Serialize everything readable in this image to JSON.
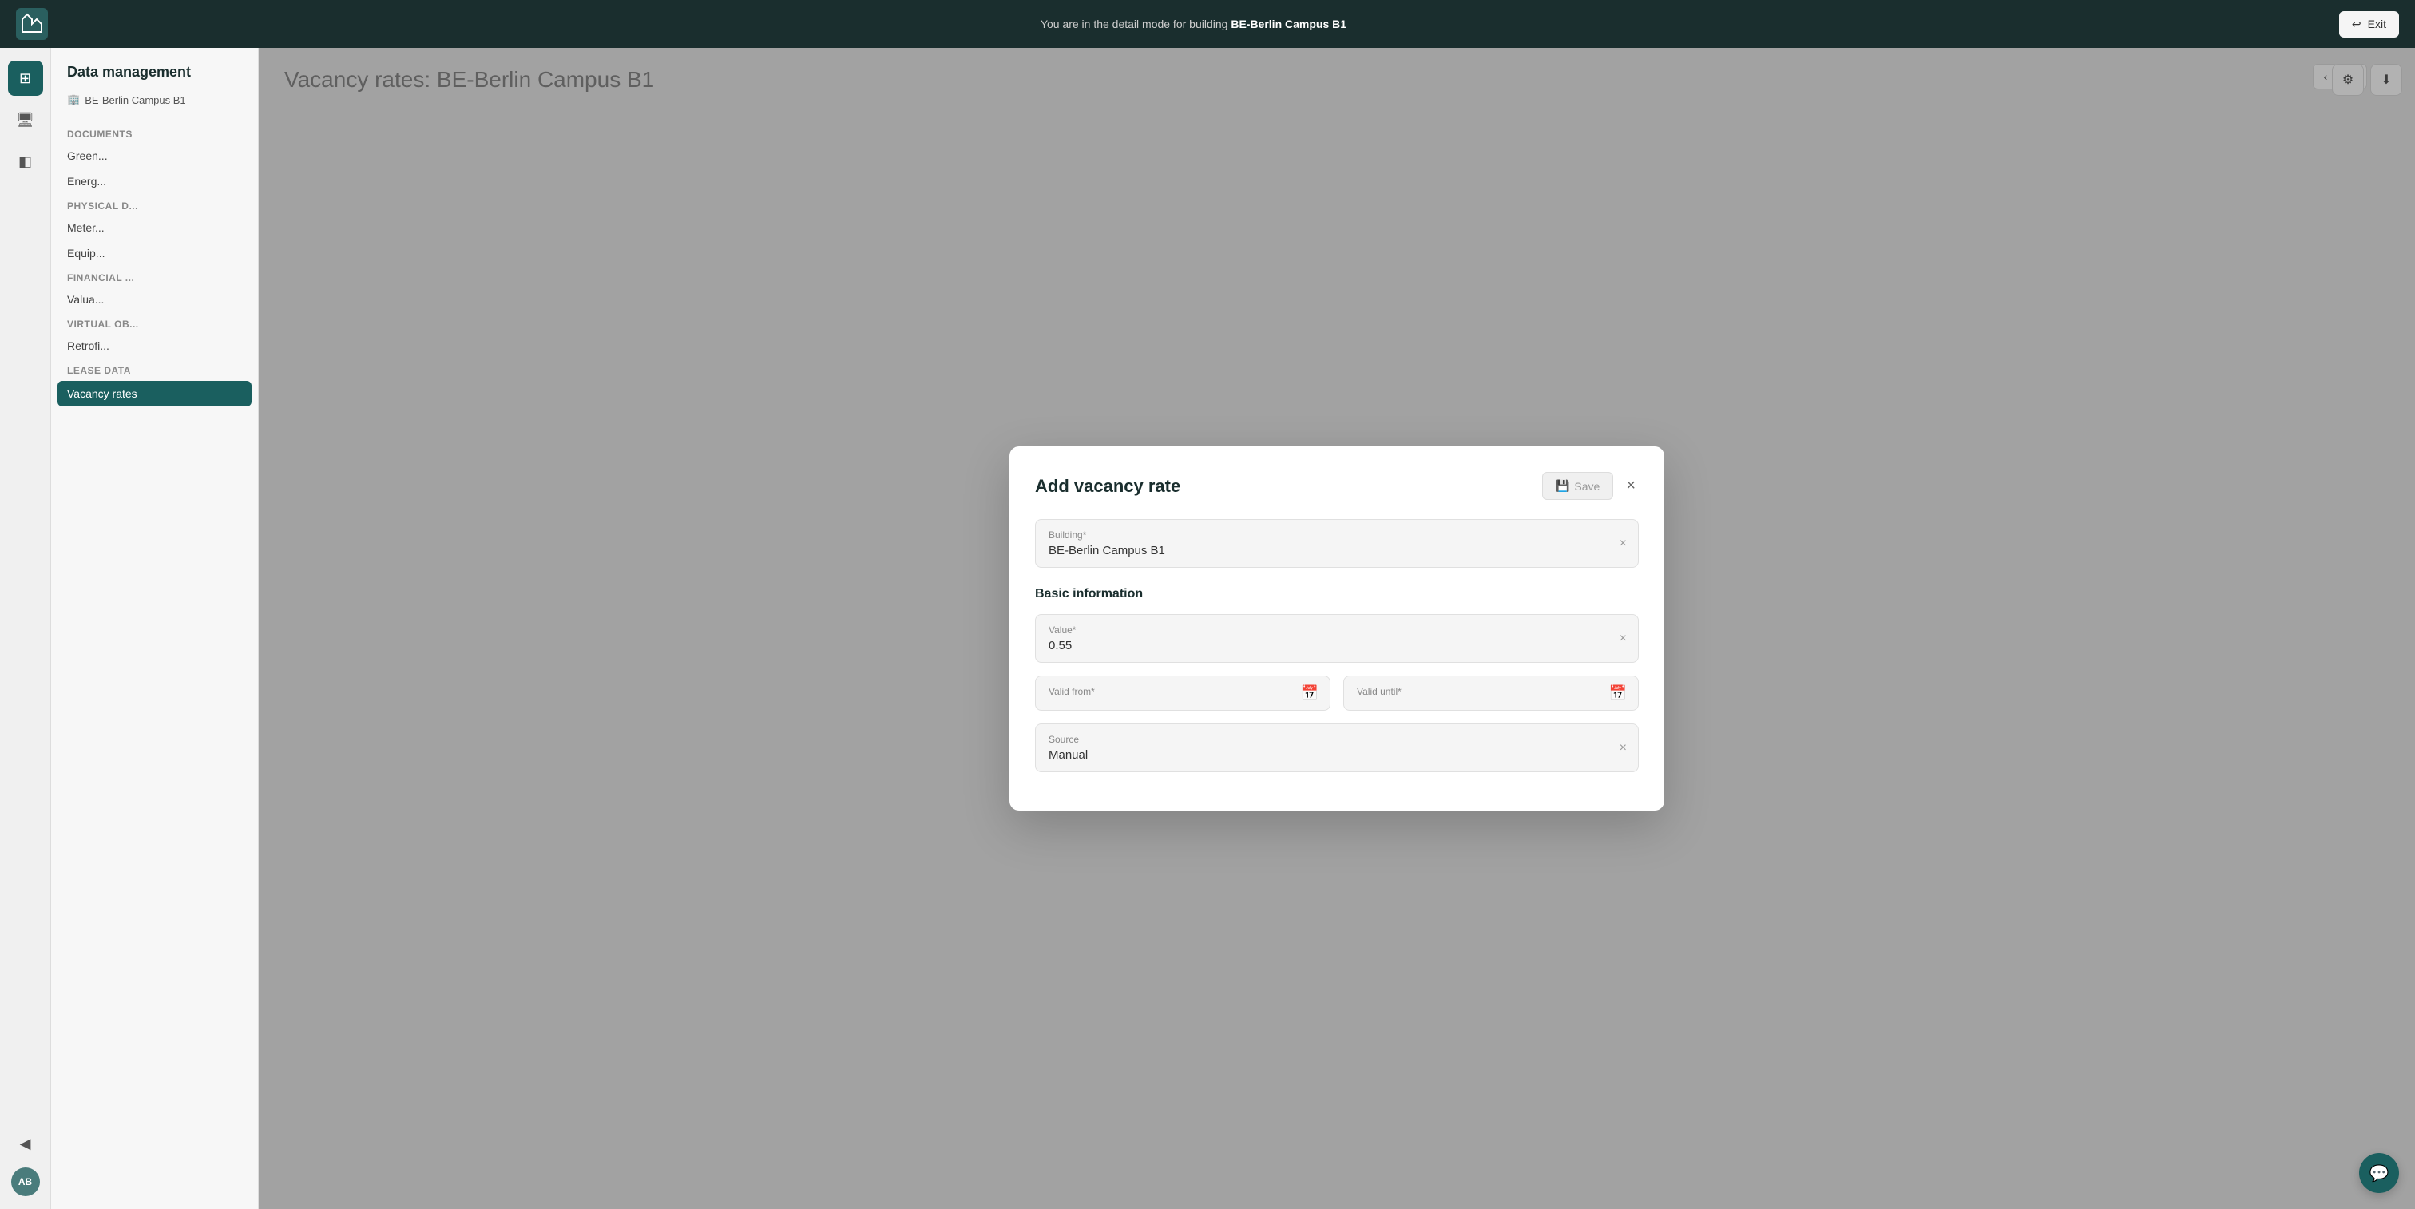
{
  "app": {
    "logo_alt": "App Logo",
    "building_mode_text": "You are in the detail mode for building ",
    "building_name": "BE-Berlin Campus B1",
    "exit_label": "Exit"
  },
  "sidebar": {
    "items": [
      {
        "icon": "⊞",
        "label": "grid-icon",
        "active": true
      },
      {
        "icon": "🖥",
        "label": "monitor-icon",
        "active": false
      },
      {
        "icon": "◧",
        "label": "layout-icon",
        "active": false
      }
    ],
    "avatar": "AB"
  },
  "left_panel": {
    "title": "Data management",
    "building_icon": "🏢",
    "building_name": "BE-Berlin Campus B1",
    "sections": [
      {
        "label": "Documents",
        "items": [
          {
            "label": "Green...",
            "active": false
          },
          {
            "label": "Energ...",
            "active": false
          }
        ]
      },
      {
        "label": "Physical d...",
        "items": [
          {
            "label": "Meter...",
            "active": false
          },
          {
            "label": "Equip...",
            "active": false
          }
        ]
      },
      {
        "label": "Financial ...",
        "items": [
          {
            "label": "Valua...",
            "active": false
          }
        ]
      },
      {
        "label": "Virtual ob...",
        "items": [
          {
            "label": "Retrofi...",
            "active": false
          }
        ]
      },
      {
        "label": "Lease data",
        "items": [
          {
            "label": "Vacancy rates",
            "active": true
          }
        ]
      }
    ]
  },
  "page": {
    "title": "Vacancy rates",
    "subtitle": ": BE-Berlin Campus B1"
  },
  "modal": {
    "title": "Add vacancy rate",
    "save_label": "Save",
    "close_label": "×",
    "building_field": {
      "label": "Building*",
      "value": "BE-Berlin Campus B1"
    },
    "basic_info_section": "Basic information",
    "value_field": {
      "label": "Value*",
      "value": "0.55"
    },
    "valid_from_field": {
      "label": "Valid from*",
      "placeholder": ""
    },
    "valid_until_field": {
      "label": "Valid until*",
      "placeholder": ""
    },
    "source_field": {
      "label": "Source",
      "value": "Manual"
    }
  },
  "icons": {
    "save": "💾",
    "calendar": "📅",
    "gear": "⚙",
    "download": "⬇",
    "chat": "💬",
    "building": "🏢",
    "exit": "↩"
  }
}
